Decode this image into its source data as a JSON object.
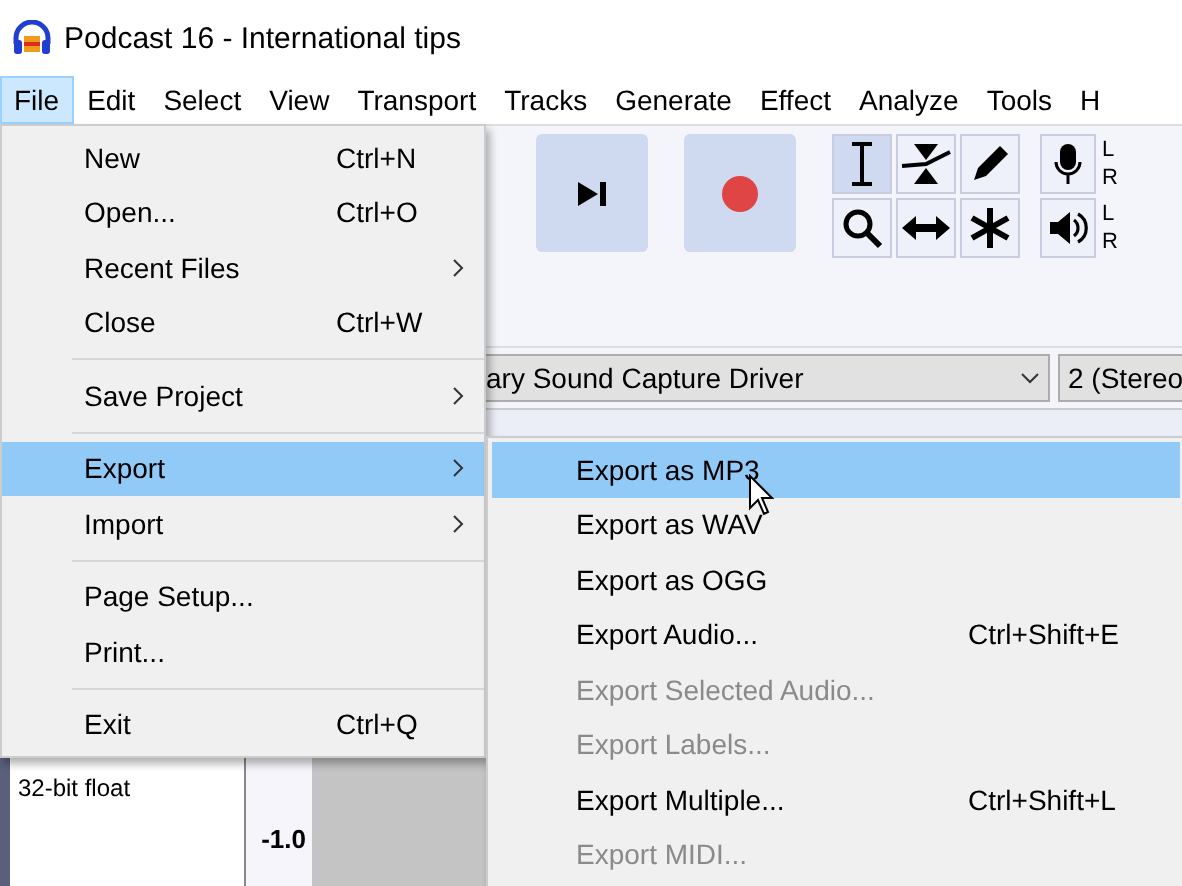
{
  "window": {
    "title": "Podcast 16 - International tips"
  },
  "menubar": [
    {
      "label": "File",
      "selected": true
    },
    {
      "label": "Edit",
      "selected": false
    },
    {
      "label": "Select",
      "selected": false
    },
    {
      "label": "View",
      "selected": false
    },
    {
      "label": "Transport",
      "selected": false
    },
    {
      "label": "Tracks",
      "selected": false
    },
    {
      "label": "Generate",
      "selected": false
    },
    {
      "label": "Effect",
      "selected": false
    },
    {
      "label": "Analyze",
      "selected": false
    },
    {
      "label": "Tools",
      "selected": false
    },
    {
      "label": "H",
      "selected": false
    }
  ],
  "meters": [
    {
      "left": "L",
      "right": "R"
    },
    {
      "left": "L",
      "right": "R"
    }
  ],
  "device_toolbar": {
    "recording_device": "ary Sound Capture Driver",
    "channels": "2 (Stereo"
  },
  "track": {
    "format": "32-bit float",
    "scale_label": "-1.0"
  },
  "file_menu": [
    {
      "kind": "item",
      "label": "New",
      "shortcut": "Ctrl+N",
      "submenu": false,
      "selected": false
    },
    {
      "kind": "item",
      "label": "Open...",
      "shortcut": "Ctrl+O",
      "submenu": false,
      "selected": false
    },
    {
      "kind": "item",
      "label": "Recent Files",
      "submenu": true,
      "selected": false
    },
    {
      "kind": "item",
      "label": "Close",
      "shortcut": "Ctrl+W",
      "submenu": false,
      "selected": false
    },
    {
      "kind": "separator"
    },
    {
      "kind": "item",
      "label": "Save Project",
      "submenu": true,
      "selected": false
    },
    {
      "kind": "separator"
    },
    {
      "kind": "item",
      "label": "Export",
      "submenu": true,
      "selected": true
    },
    {
      "kind": "item",
      "label": "Import",
      "submenu": true,
      "selected": false
    },
    {
      "kind": "separator"
    },
    {
      "kind": "item",
      "label": "Page Setup...",
      "submenu": false,
      "selected": false
    },
    {
      "kind": "item",
      "label": "Print...",
      "submenu": false,
      "selected": false
    },
    {
      "kind": "separator"
    },
    {
      "kind": "item",
      "label": "Exit",
      "shortcut": "Ctrl+Q",
      "submenu": false,
      "selected": false
    }
  ],
  "export_submenu": [
    {
      "label": "Export as MP3",
      "selected": true,
      "disabled": false
    },
    {
      "label": "Export as WAV",
      "selected": false,
      "disabled": false
    },
    {
      "label": "Export as OGG",
      "selected": false,
      "disabled": false
    },
    {
      "label": "Export Audio...",
      "shortcut": "Ctrl+Shift+E",
      "selected": false,
      "disabled": false
    },
    {
      "label": "Export Selected Audio...",
      "selected": false,
      "disabled": true
    },
    {
      "label": "Export Labels...",
      "selected": false,
      "disabled": true
    },
    {
      "label": "Export Multiple...",
      "shortcut": "Ctrl+Shift+L",
      "selected": false,
      "disabled": false
    },
    {
      "label": "Export MIDI...",
      "selected": false,
      "disabled": true
    }
  ]
}
